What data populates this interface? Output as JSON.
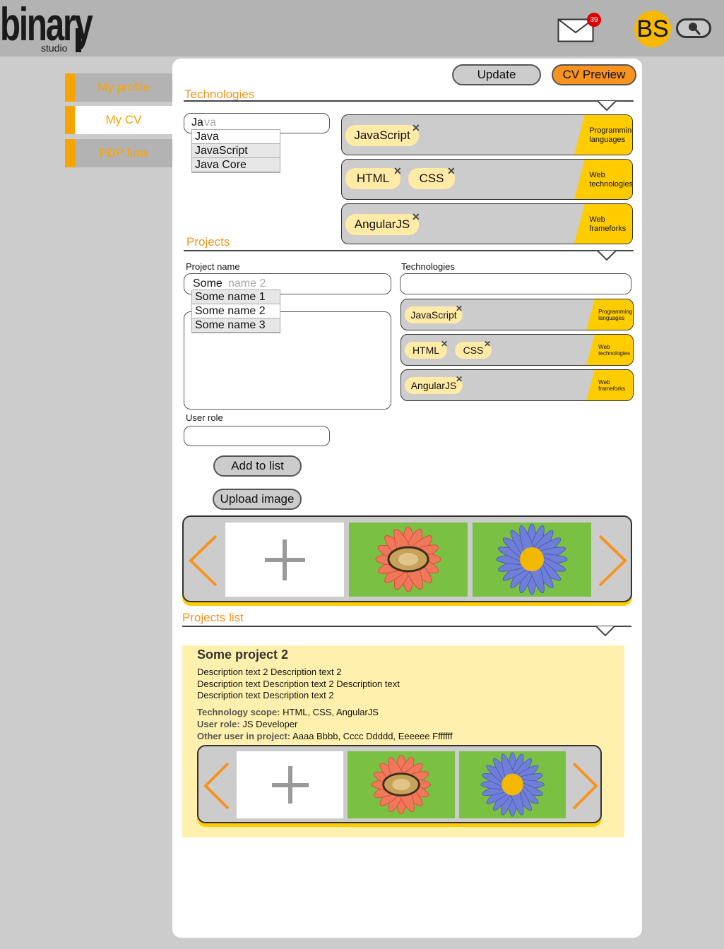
{
  "header": {
    "logo": "binary",
    "logo_sub": "studio",
    "mail_count": "39",
    "avatar_initials": "BS"
  },
  "sidebar": {
    "items": [
      {
        "label": "My profile"
      },
      {
        "label": "My CV"
      },
      {
        "label": "PDP flow"
      }
    ]
  },
  "toolbar": {
    "update_label": "Update",
    "cv_preview_label": "CV Preview"
  },
  "technologies": {
    "title": "Technologies",
    "input_typed": "Ja",
    "input_hint": "va",
    "suggestions": [
      "Java",
      "JavaScript",
      "Java Core"
    ],
    "groups": [
      {
        "category": "Programming languages",
        "tags": [
          "JavaScript"
        ]
      },
      {
        "category": "Web technologies",
        "tags": [
          "HTML",
          "CSS"
        ]
      },
      {
        "category": "Web frameforks",
        "tags": [
          "AngularJS"
        ]
      }
    ]
  },
  "projects": {
    "title": "Projects",
    "name_label": "Project name",
    "name_typed": "Some",
    "name_hint": "name 2",
    "name_suggestions": [
      "Some name 1",
      "Some name 2",
      "Some name 3"
    ],
    "tech_label": "Technologies",
    "user_role_label": "User role",
    "add_button": "Add to list",
    "upload_button": "Upload image",
    "groups": [
      {
        "category": "Programming languages",
        "tags": [
          "JavaScript"
        ]
      },
      {
        "category": "Web technologies",
        "tags": [
          "HTML",
          "CSS"
        ]
      },
      {
        "category": "Web frameforks",
        "tags": [
          "AngularJS"
        ]
      }
    ]
  },
  "projects_list": {
    "title": "Projects list",
    "card": {
      "name": "Some project 2",
      "description": [
        "Description text 2 Description text 2",
        "Description text Description text 2 Description text",
        "Description text Description text 2"
      ],
      "tech_key": "Technology scope:",
      "tech_val": "HTML, CSS, AngularJS",
      "role_key": "User role:",
      "role_val": "JS Developer",
      "others_key": "Other user in project:",
      "others_val": "Aaaa Bbbb, Cccc Ddddd, Eeeeee Fffffff"
    }
  },
  "colors": {
    "accent": "#f7931e",
    "tag_category": "#ffcc00",
    "chip": "#ffeaa6",
    "card": "#fff1ad"
  },
  "icons": [
    "mail-icon",
    "search-icon",
    "close-icon",
    "chevron-down-icon",
    "plus-icon",
    "arrow-left-icon",
    "arrow-right-icon"
  ]
}
